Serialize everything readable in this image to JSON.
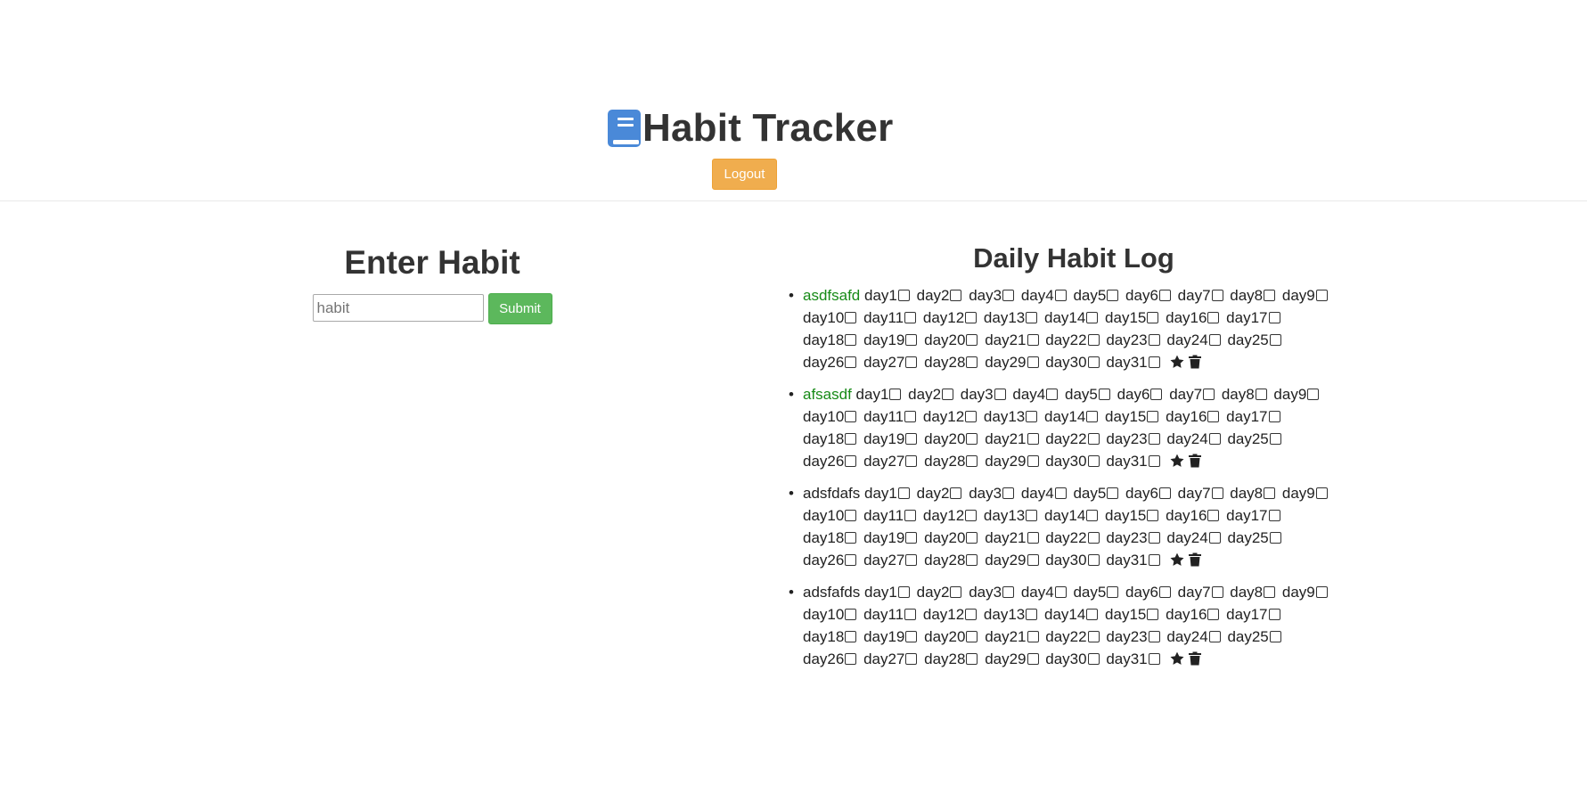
{
  "header": {
    "title": "Habit Tracker",
    "logout_label": "Logout"
  },
  "enter_habit": {
    "title": "Enter Habit",
    "input_placeholder": "habit",
    "submit_label": "Submit"
  },
  "log": {
    "title": "Daily Habit Log",
    "habits": [
      {
        "name": "asdfsafd",
        "name_color": "#178a17"
      },
      {
        "name": "afsasdf",
        "name_color": "#178a17"
      },
      {
        "name": "adsfdafs",
        "name_color": "#222222"
      },
      {
        "name": "adsfafds",
        "name_color": "#222222"
      }
    ],
    "day_labels": [
      "day1",
      "day2",
      "day3",
      "day4",
      "day5",
      "day6",
      "day7",
      "day8",
      "day9",
      "day10",
      "day11",
      "day12",
      "day13",
      "day14",
      "day15",
      "day16",
      "day17",
      "day18",
      "day19",
      "day20",
      "day21",
      "day22",
      "day23",
      "day24",
      "day25",
      "day26",
      "day27",
      "day28",
      "day29",
      "day30",
      "day31"
    ],
    "action_icons": [
      "star-icon",
      "trash-icon"
    ]
  },
  "colors": {
    "logout_button": "#f0ad4e",
    "submit_button": "#5cb85c",
    "brand_icon": "#4a89d8",
    "highlight_name": "#178a17"
  }
}
